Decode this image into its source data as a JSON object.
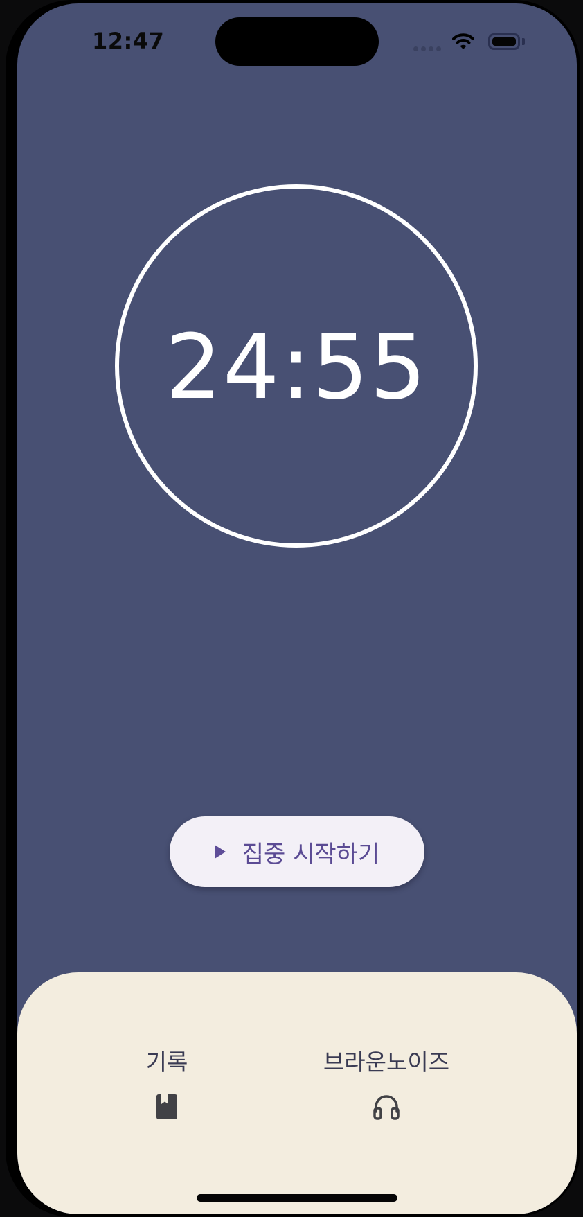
{
  "status_bar": {
    "time": "12:47"
  },
  "timer": {
    "display": "24:55"
  },
  "start_button": {
    "icon": "play-icon",
    "label": "집중 시작하기"
  },
  "bottom_nav": {
    "items": [
      {
        "label": "기록",
        "icon": "book-icon"
      },
      {
        "label": "브라운노이즈",
        "icon": "headphones-icon"
      }
    ]
  },
  "colors": {
    "background": "#485073",
    "panel": "#f3eddf",
    "button": "#f3f0f7",
    "accent": "#5b4b94"
  }
}
